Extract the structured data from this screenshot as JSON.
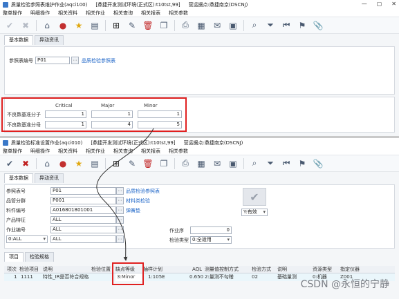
{
  "win1": {
    "title": "质量检验参照表维护作业(aqci100)",
    "env": "[鼎捷开发测试环境(正式区):t10tst,99]",
    "user": "营运据点:鼎捷南京(DSCNJ)",
    "menu": [
      "整单操作",
      "明细操作",
      "相关资料",
      "相关作业",
      "相关查询",
      "相关报表",
      "相关参数"
    ],
    "tabs": [
      "基本数据",
      "异动资讯"
    ],
    "ref_label": "参照表编号",
    "ref_value": "P01",
    "ref_link": "品质检验参照表",
    "col_headers": [
      "Critical",
      "Major",
      "Minor"
    ],
    "row1_label": "不良数基准分子",
    "row1_values": [
      "1",
      "1",
      "1"
    ],
    "row2_label": "不良数基准分母",
    "row2_values": [
      "1",
      "4",
      "5"
    ]
  },
  "win2": {
    "title": "质量检验标准设置作业(aqci010)",
    "env": "[鼎捷开发测试环境(正式区):t10tst,99]",
    "user": "营运据点:鼎捷南京(DSCNJ)",
    "menu": [
      "整单操作",
      "明细操作",
      "相关资料",
      "相关作业",
      "相关查询",
      "相关报表",
      "相关参数"
    ],
    "tabs": [
      "基本数据",
      "异动资讯"
    ],
    "fields": {
      "ref_label": "参照表号",
      "ref_value": "P01",
      "ref_link": "品质检验参照表",
      "mgmt_label": "品管分群",
      "mgmt_value": "P001",
      "mgmt_link": "材料类检验",
      "item_label": "料件编号",
      "item_value": "A016801801001",
      "item_link": "弹簧垫",
      "feature_label": "产品特征",
      "feature_value": "ALL",
      "op_label": "作业编号",
      "op_value": "ALL",
      "combo_value": "0:ALL",
      "combo2_value": "ALL",
      "seq_label": "作业序",
      "seq_value": "0",
      "insp_type_label": "检验类型",
      "insp_type_value": "0:全适用",
      "status_value": "Y:有效"
    },
    "detail_tabs": [
      "项目",
      "检验规格"
    ],
    "grid_headers": [
      "项次",
      "检验项目",
      "说明",
      "检验位置",
      "缺点等级",
      "抽样计划",
      "AQL",
      "测量值控制方式",
      "检验方式",
      "说明",
      "资源类型",
      "指定仪器"
    ],
    "grid_row": [
      "1",
      "1111",
      "特性_IR是否符合规格",
      "",
      "3:Minor",
      "1:105E",
      "0.650",
      "2:量测不勾稽",
      "02",
      "基础量测",
      "0:机器",
      "Z001"
    ]
  },
  "watermark": "CSDN @永恒的宁静"
}
